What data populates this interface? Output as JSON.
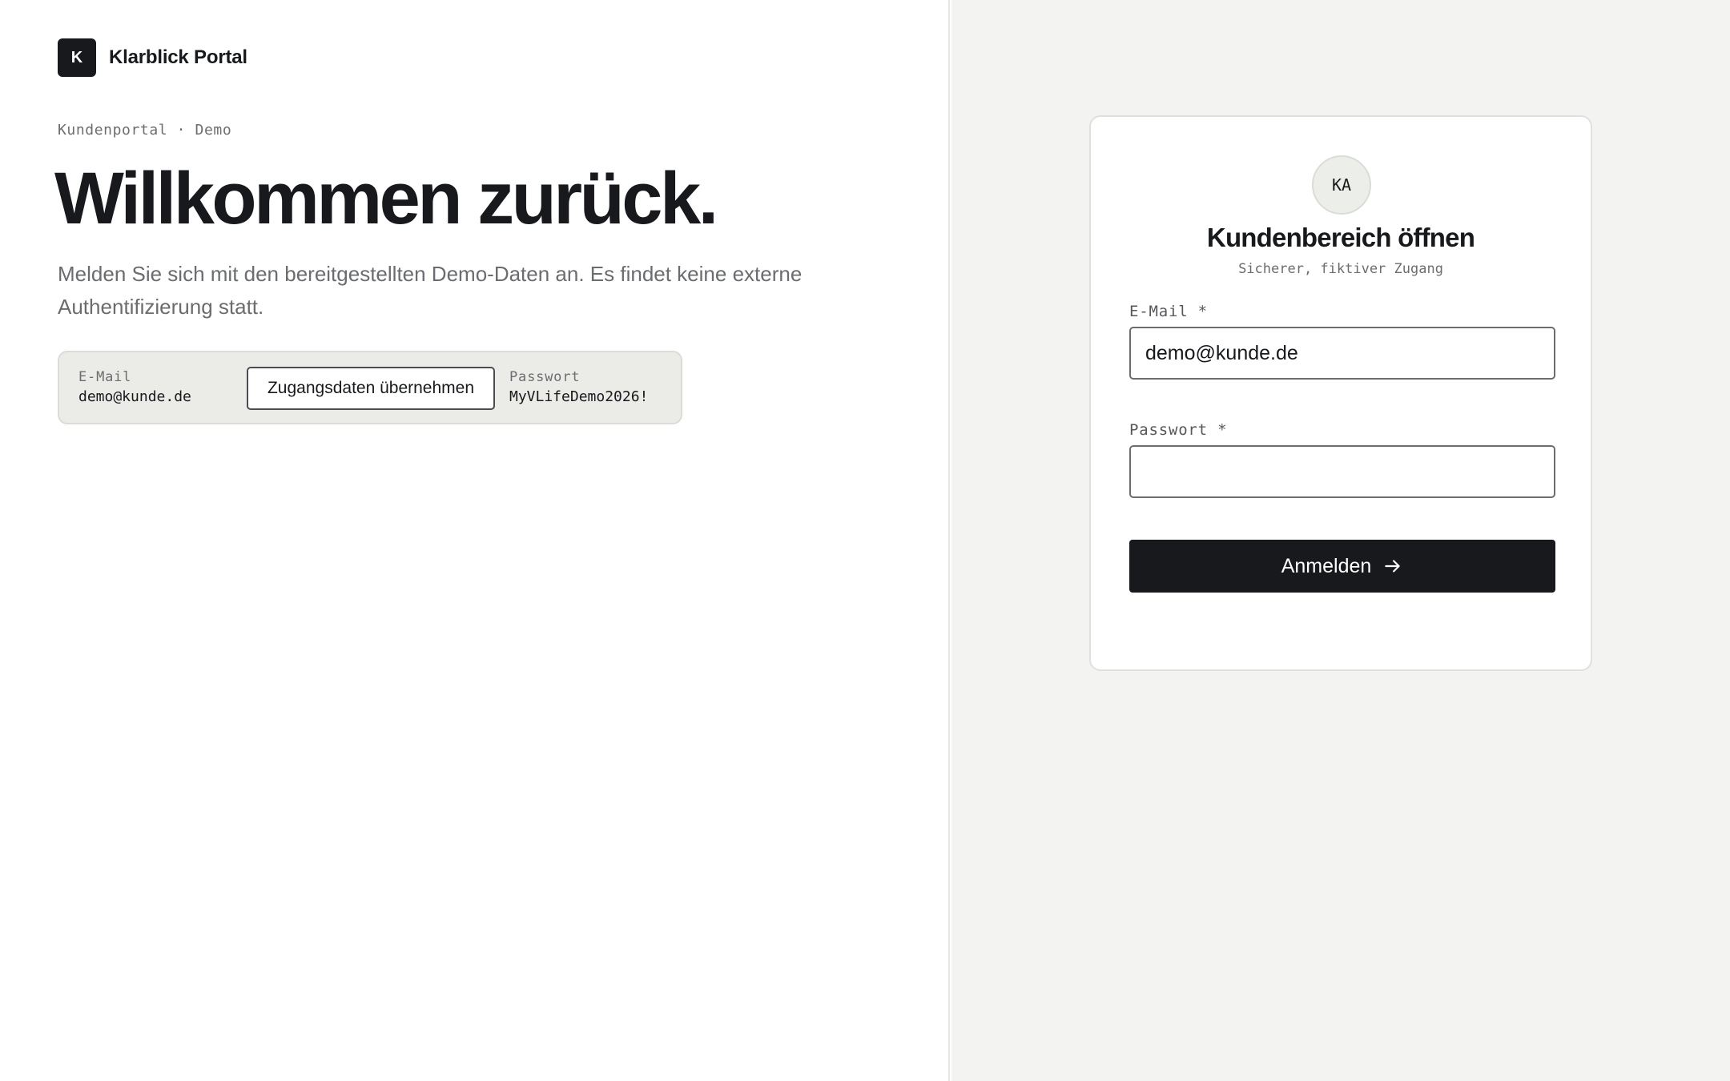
{
  "brand": {
    "mark": "K",
    "name": "Klarblick Portal"
  },
  "hero": {
    "eyebrow": "Kundenportal · Demo",
    "headline": "Willkommen zurück.",
    "lead": "Melden Sie sich mit den bereitgestellten Demo-Daten an. Es findet keine externe Authentifizierung statt."
  },
  "demo_credentials": {
    "email_label": "E-Mail",
    "email_value": "demo@kunde.de",
    "fill_button": "Zugangsdaten übernehmen",
    "password_label": "Passwort",
    "password_value": "MyVLifeDemo2026!"
  },
  "login_card": {
    "avatar_initials": "KA",
    "title": "Kundenbereich öffnen",
    "subtitle": "Sicherer, fiktiver Zugang",
    "email_label": "E-Mail *",
    "email_value": "demo@kunde.de",
    "password_label": "Passwort *",
    "password_value": "",
    "submit_label": "Anmelden",
    "submit_icon": "arrow-right-icon"
  },
  "colors": {
    "ink": "#17191c",
    "right_background": "#f3f3f1",
    "demo_box_background": "#ebebe7"
  }
}
